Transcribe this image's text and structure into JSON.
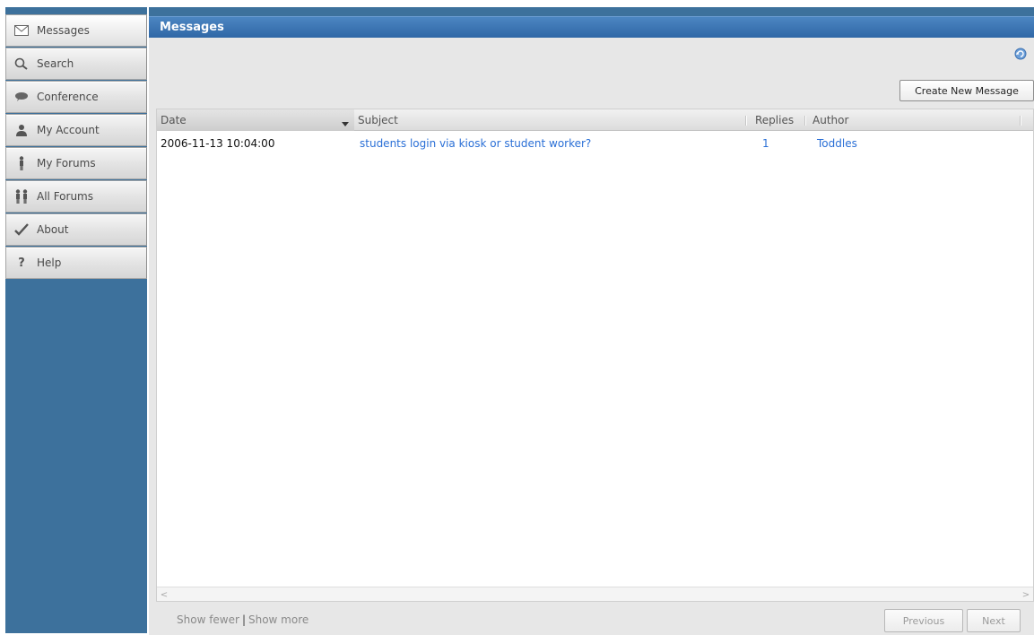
{
  "sidebar": {
    "items": [
      {
        "label": "Messages",
        "icon": "envelope-icon"
      },
      {
        "label": "Search",
        "icon": "magnifier-icon"
      },
      {
        "label": "Conference",
        "icon": "speech-bubble-icon"
      },
      {
        "label": "My Account",
        "icon": "user-icon"
      },
      {
        "label": "My Forums",
        "icon": "person-icon"
      },
      {
        "label": "All Forums",
        "icon": "people-icon"
      },
      {
        "label": "About",
        "icon": "checkmark-icon"
      },
      {
        "label": "Help",
        "icon": "question-icon"
      }
    ]
  },
  "main": {
    "title": "Messages",
    "create_button": "Create New Message",
    "columns": {
      "date": "Date",
      "subject": "Subject",
      "replies": "Replies",
      "author": "Author"
    },
    "rows": [
      {
        "date": "2006-11-13 10:04:00",
        "subject": "students login via kiosk or student worker?",
        "replies": "1",
        "author": "Toddles"
      }
    ]
  },
  "footer": {
    "show_fewer": "Show fewer",
    "separator": "|",
    "show_more": "Show more",
    "previous": "Previous",
    "next": "Next"
  },
  "colors": {
    "sidebar_bg": "#3d719c",
    "titlebar": "#3a74b4",
    "link": "#2a6fd6"
  }
}
